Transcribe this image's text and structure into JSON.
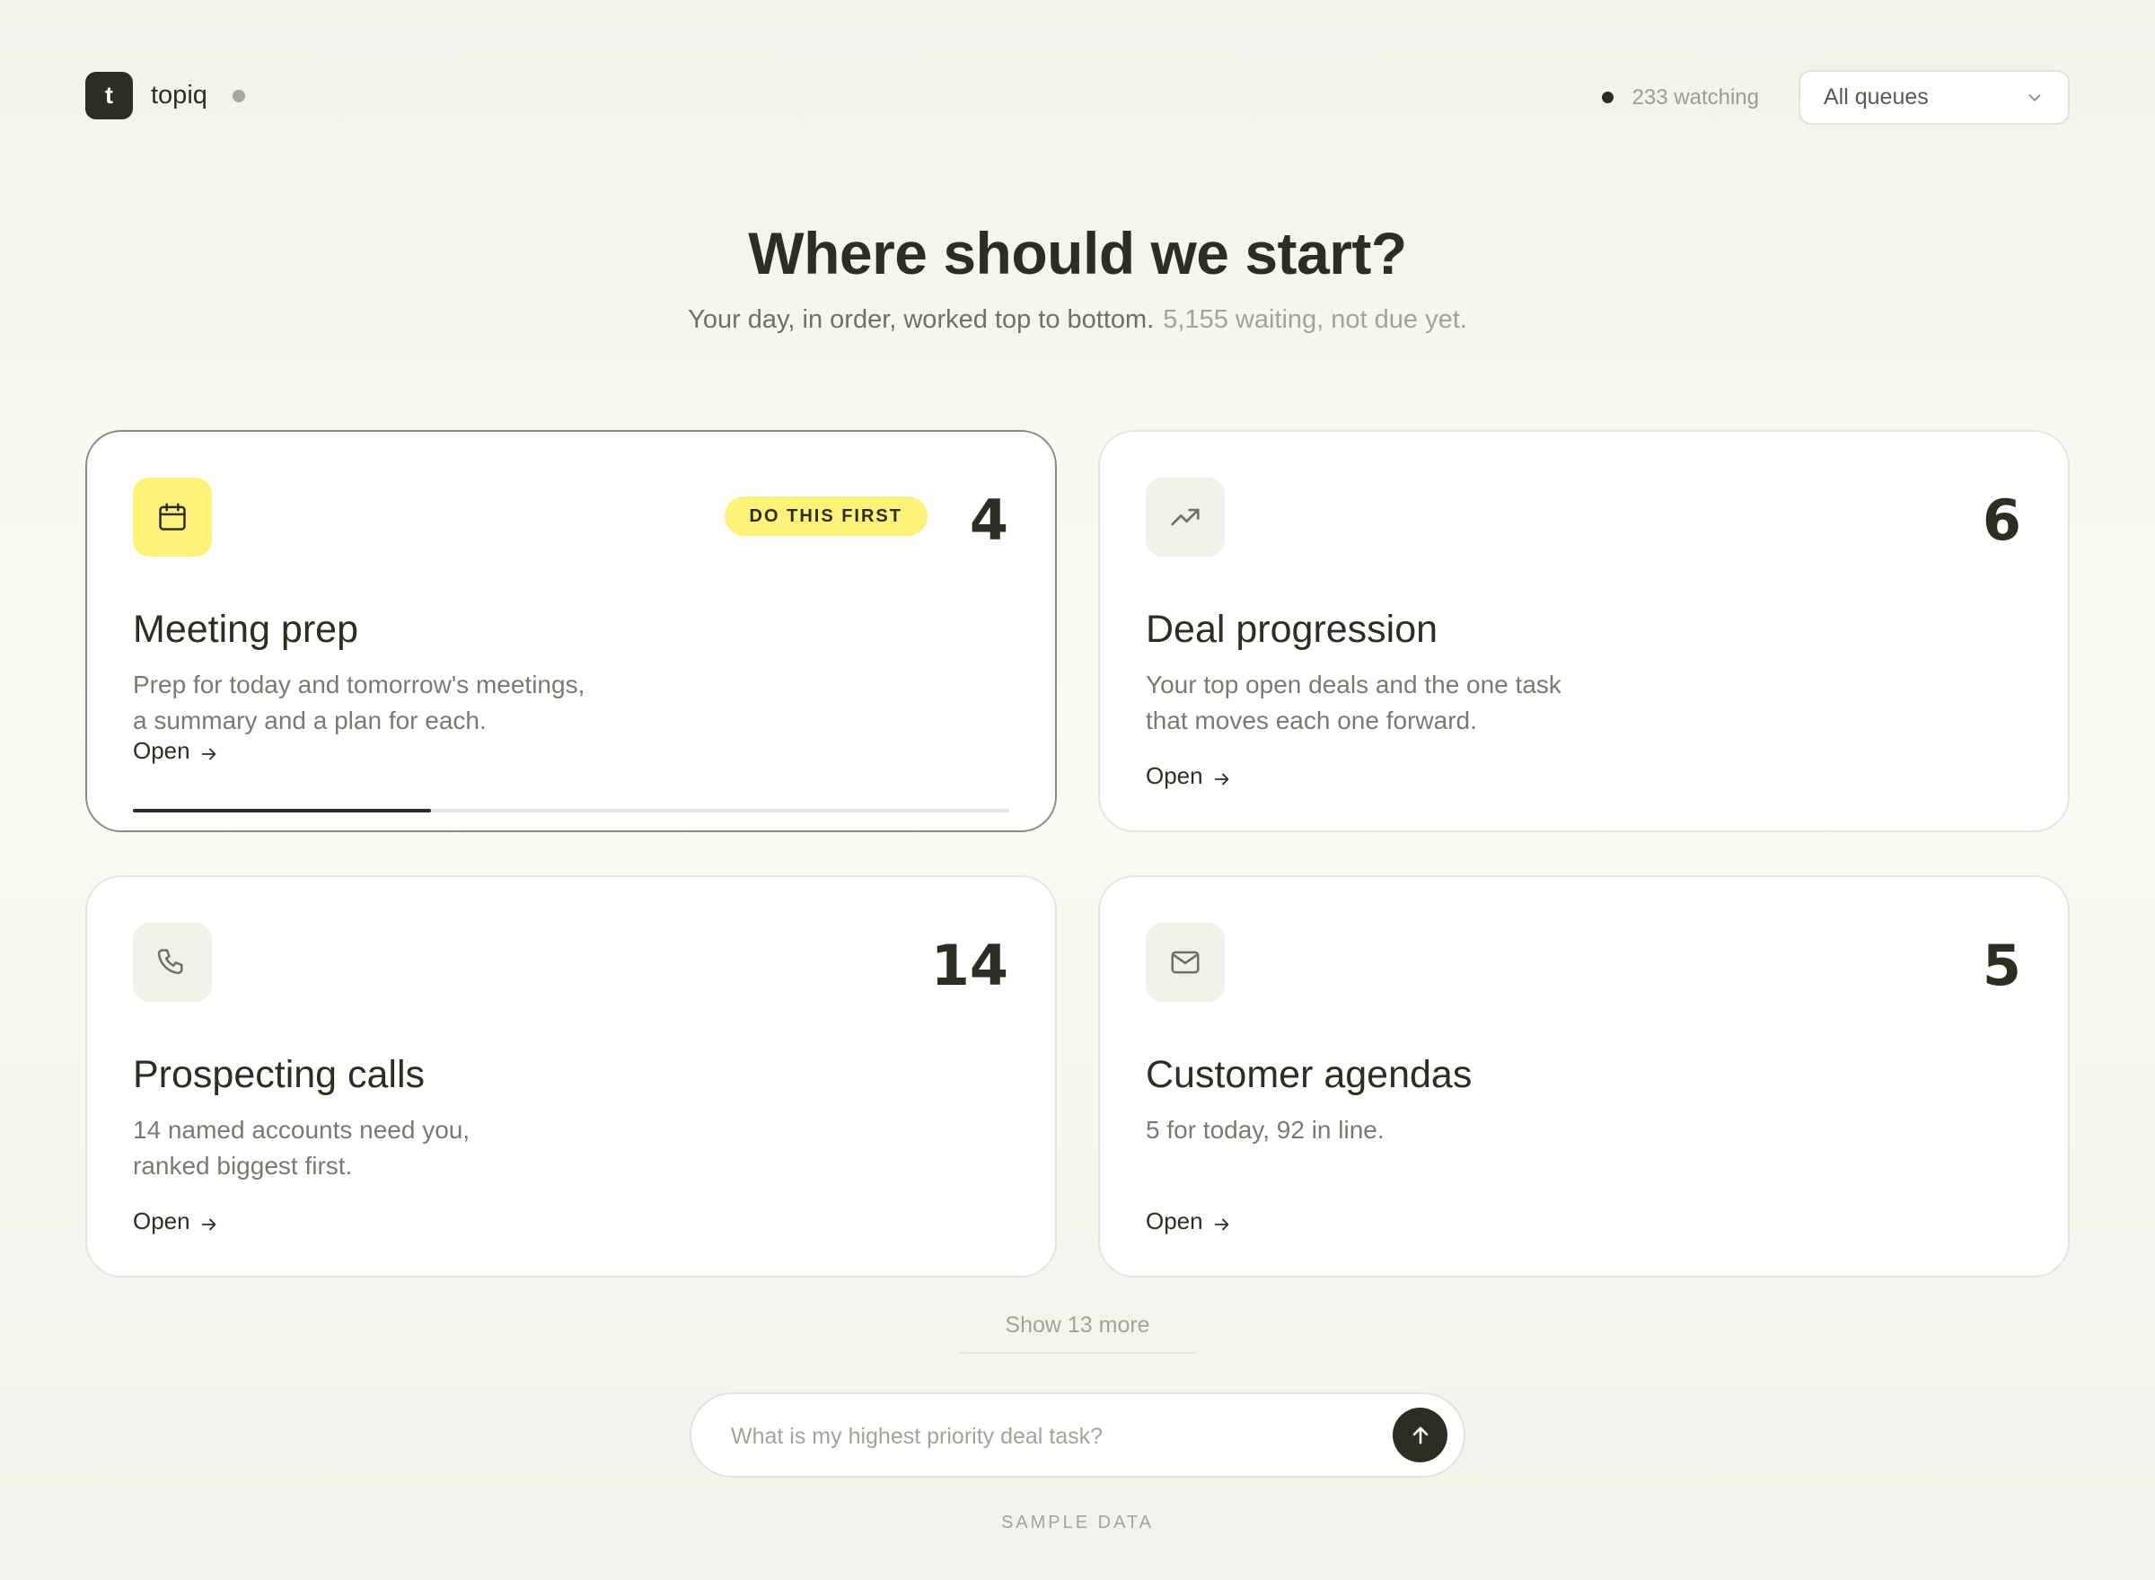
{
  "brand": {
    "logo_letter": "t",
    "name": "topiq"
  },
  "header": {
    "watching": "233 watching",
    "queue_select": "All queues"
  },
  "hero": {
    "title": "Where should we start?",
    "subtitle": "Your day, in order, worked top to bottom.",
    "subtitle_muted": "5,155 waiting, not due yet."
  },
  "cards": [
    {
      "icon": "calendar-icon",
      "badge": "DO THIS FIRST",
      "count": "4",
      "title": "Meeting prep",
      "desc_line1": "Prep for today and tomorrow's meetings,",
      "desc_line2": "a summary and a plan for each.",
      "open_label": "Open",
      "progress": 0.34
    },
    {
      "icon": "trending-up-icon",
      "count": "6",
      "title": "Deal progression",
      "desc_line1": "Your top open deals and the one task",
      "desc_line2": "that moves each one forward.",
      "open_label": "Open"
    },
    {
      "icon": "phone-icon",
      "count": "14",
      "title": "Prospecting calls",
      "desc_line1": "14 named accounts need you,",
      "desc_line2": "ranked biggest first.",
      "open_label": "Open"
    },
    {
      "icon": "mail-icon",
      "count": "5",
      "title": "Customer agendas",
      "desc_line1": "5 for today, 92 in line.",
      "desc_line2": "",
      "open_label": "Open"
    }
  ],
  "show_more": "Show 13 more",
  "ask": {
    "placeholder": "What is my highest priority deal task?"
  },
  "footer": {
    "sample": "SAMPLE DATA"
  },
  "colors": {
    "accent_yellow": "#fdf27a",
    "ink": "#2d2e22",
    "muted": "#a3a399"
  }
}
